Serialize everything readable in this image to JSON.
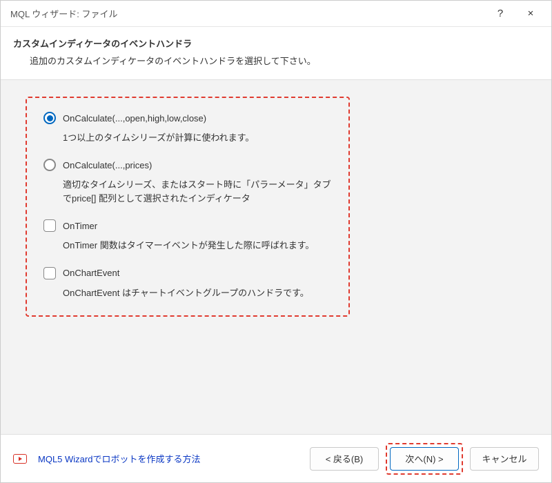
{
  "titlebar": {
    "title": "MQL ウィザード: ファイル",
    "help": "?",
    "close": "×"
  },
  "header": {
    "title": "カスタムインディケータのイベントハンドラ",
    "subtitle": "追加のカスタムインディケータのイベントハンドラを選択して下さい。"
  },
  "options": [
    {
      "kind": "radio",
      "selected": true,
      "label": "OnCalculate(...,open,high,low,close)",
      "desc": "1つ以上のタイムシリーズが計算に使われます。"
    },
    {
      "kind": "radio",
      "selected": false,
      "label": "OnCalculate(...,prices)",
      "desc": "適切なタイムシリーズ、またはスタート時に「パラーメータ」タブでprice[] 配列として選択されたインディケータ"
    },
    {
      "kind": "check",
      "selected": false,
      "label": "OnTimer",
      "desc": "OnTimer 関数はタイマーイベントが発生した際に呼ばれます。"
    },
    {
      "kind": "check",
      "selected": false,
      "label": "OnChartEvent",
      "desc": "OnChartEvent はチャートイベントグループのハンドラです。"
    }
  ],
  "footer": {
    "help_link": "MQL5 Wizardでロボットを作成する方法",
    "back": "< 戻る(B)",
    "next": "次へ(N) >",
    "cancel": "キャンセル"
  }
}
